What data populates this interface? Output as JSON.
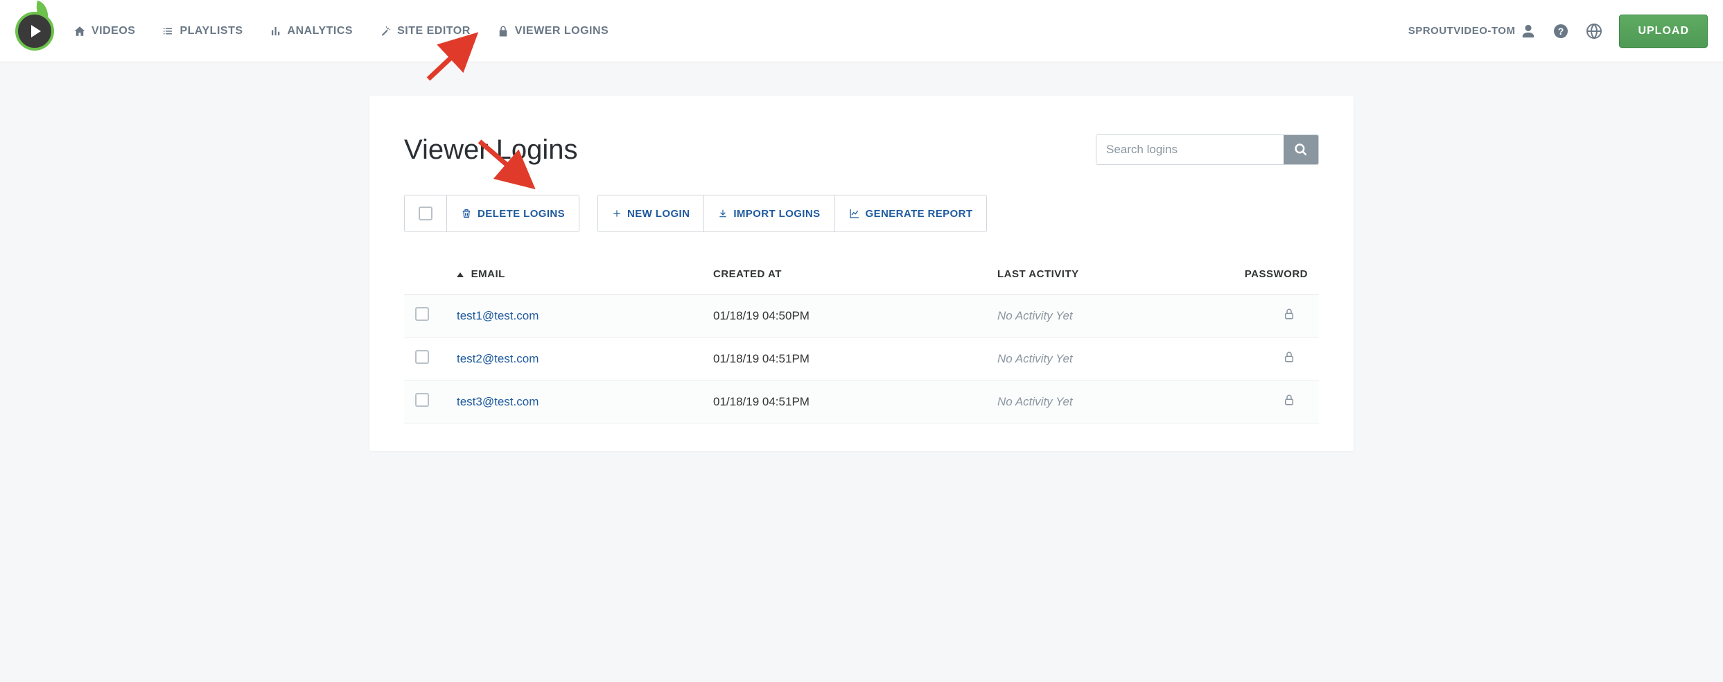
{
  "nav": {
    "videos": "Videos",
    "playlists": "Playlists",
    "analytics": "Analytics",
    "site_editor": "Site Editor",
    "viewer_logins": "Viewer Logins"
  },
  "user": {
    "name": "SPROUTVIDEO-TOM",
    "upload_label": "Upload"
  },
  "page": {
    "title": "Viewer Logins"
  },
  "search": {
    "placeholder": "Search logins"
  },
  "toolbar": {
    "delete_label": "Delete Logins",
    "new_label": "New Login",
    "import_label": "Import Logins",
    "report_label": "Generate Report"
  },
  "table": {
    "headers": {
      "email": "Email",
      "created_at": "Created At",
      "last_activity": "Last Activity",
      "password": "Password"
    },
    "rows": [
      {
        "email": "test1@test.com",
        "created_at": "01/18/19 04:50PM",
        "last_activity": "No Activity Yet"
      },
      {
        "email": "test2@test.com",
        "created_at": "01/18/19 04:51PM",
        "last_activity": "No Activity Yet"
      },
      {
        "email": "test3@test.com",
        "created_at": "01/18/19 04:51PM",
        "last_activity": "No Activity Yet"
      }
    ]
  }
}
